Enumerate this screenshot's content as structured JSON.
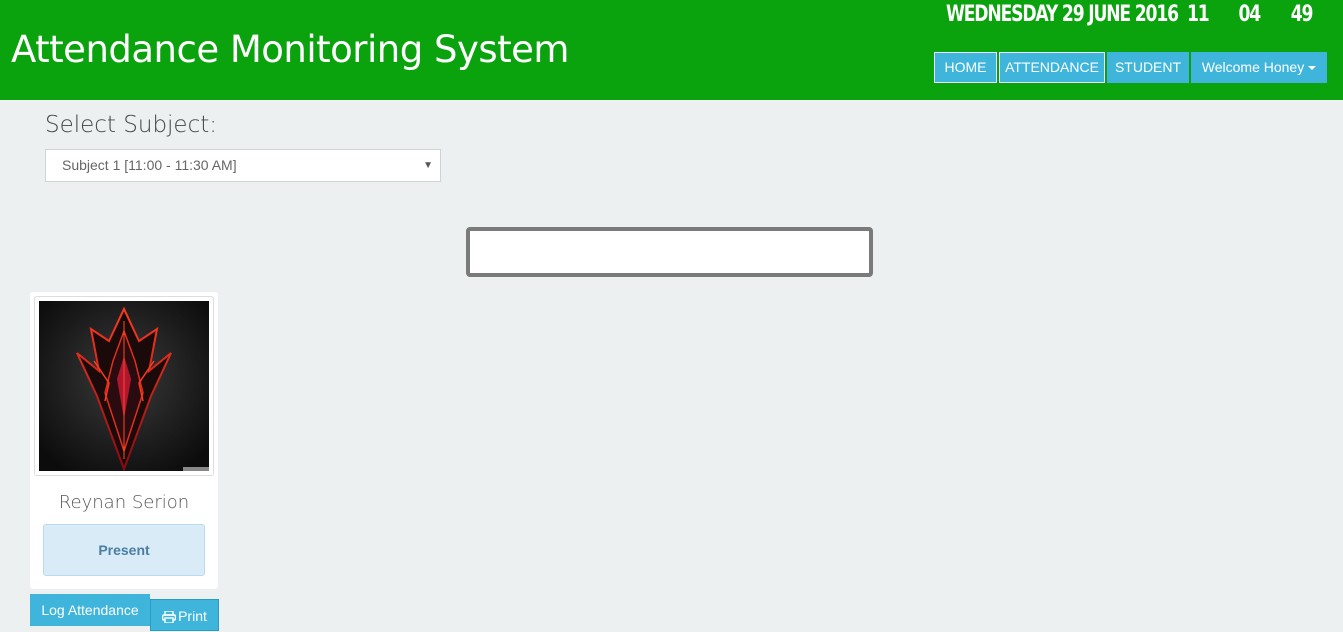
{
  "header": {
    "title": "Attendance Monitoring System",
    "datetime": {
      "date": "WEDNESDAY 29 JUNE 2016",
      "hour": "11",
      "minute": "04",
      "second": "49"
    },
    "nav": [
      {
        "label": "HOME"
      },
      {
        "label": "ATTENDANCE"
      },
      {
        "label": "STUDENT"
      },
      {
        "label": "Welcome Honey",
        "has_dropdown": true
      }
    ],
    "bg_color": "#0aa30e"
  },
  "subject": {
    "label": "Select Subject:",
    "selected": "Subject 1 [11:00 - 11:30 AM]"
  },
  "scan_input": {
    "value": ""
  },
  "student_card": {
    "name": "Reynan Serion",
    "status": "Present",
    "photo_icon": "dark-red-crest-avatar"
  },
  "actions": {
    "log_attendance": "Log Attendance",
    "print": "Print"
  },
  "colors": {
    "accent": "#3fb5dc",
    "page_bg": "#ecf0f1"
  }
}
